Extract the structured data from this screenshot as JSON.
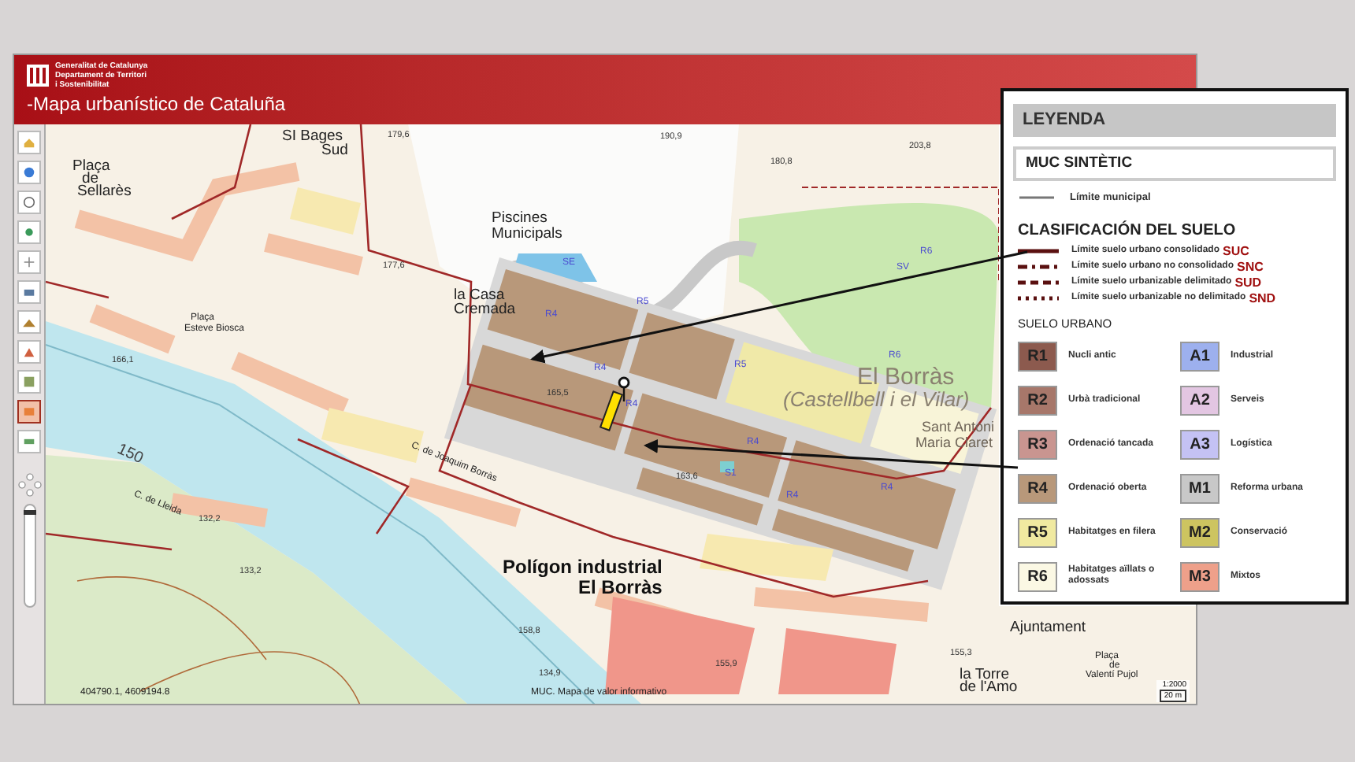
{
  "header": {
    "org_lines": [
      "Generalitat de Catalunya",
      "Departament de Territori",
      "i Sostenibilitat"
    ],
    "title": "-Mapa urbanístico de Cataluña"
  },
  "toolbar": {
    "tools": [
      {
        "selected": false
      },
      {
        "selected": false
      },
      {
        "selected": false
      },
      {
        "selected": false
      },
      {
        "selected": false
      },
      {
        "selected": false
      },
      {
        "selected": false
      },
      {
        "selected": false
      },
      {
        "selected": false
      },
      {
        "selected": true
      },
      {
        "selected": false
      }
    ],
    "zoom": {
      "level": 0.95
    }
  },
  "map": {
    "labels": [
      {
        "text": "SI Bages",
        "kind": "place"
      },
      {
        "text": "Sud",
        "kind": "place"
      },
      {
        "text": "Piscines",
        "kind": "place"
      },
      {
        "text": "Municipals",
        "kind": "place"
      },
      {
        "text": "Plaça",
        "kind": "small"
      },
      {
        "text": "Esteve Biosca",
        "kind": "small"
      },
      {
        "text": "la Casa",
        "kind": "place"
      },
      {
        "text": "Cremada",
        "kind": "place"
      },
      {
        "text": "El Borràs",
        "kind": "town"
      },
      {
        "text": "(Castellbell i el Vilar)",
        "kind": "town"
      },
      {
        "text": "Sant Antoni",
        "kind": "fade"
      },
      {
        "text": "Maria Claret",
        "kind": "fade"
      },
      {
        "text": "Polígon industrial",
        "kind": "bold"
      },
      {
        "text": "El Borràs",
        "kind": "bold"
      },
      {
        "text": "Ajuntament",
        "kind": "place"
      },
      {
        "text": "la Torre",
        "kind": "place"
      },
      {
        "text": "de l'Amo",
        "kind": "place"
      },
      {
        "text": "Plaça",
        "kind": "small"
      },
      {
        "text": "de",
        "kind": "small"
      },
      {
        "text": "Valentí Pujol",
        "kind": "small"
      },
      {
        "text": "Plaça",
        "kind": "place"
      },
      {
        "text": "de",
        "kind": "place"
      },
      {
        "text": "Sellarès",
        "kind": "place"
      },
      {
        "text": "C. de Joaquim Borràs",
        "kind": "street"
      },
      {
        "text": "C. de Lleida",
        "kind": "street"
      },
      {
        "text": "R4",
        "kind": "zone"
      },
      {
        "text": "R4",
        "kind": "zone"
      },
      {
        "text": "R4",
        "kind": "zone"
      },
      {
        "text": "R4",
        "kind": "zone"
      },
      {
        "text": "R4",
        "kind": "zone"
      },
      {
        "text": "R4",
        "kind": "zone"
      },
      {
        "text": "R5",
        "kind": "zone"
      },
      {
        "text": "R5",
        "kind": "zone"
      },
      {
        "text": "R6",
        "kind": "zone"
      },
      {
        "text": "R6",
        "kind": "zone"
      },
      {
        "text": "SE",
        "kind": "zone"
      },
      {
        "text": "SV",
        "kind": "zone"
      },
      {
        "text": "S1",
        "kind": "zone"
      },
      {
        "text": "150",
        "kind": "contour"
      },
      {
        "text": "190,9",
        "kind": "height"
      },
      {
        "text": "203,8",
        "kind": "height"
      },
      {
        "text": "180,8",
        "kind": "height"
      },
      {
        "text": "179,6",
        "kind": "height"
      },
      {
        "text": "177,6",
        "kind": "height"
      },
      {
        "text": "165,5",
        "kind": "height"
      },
      {
        "text": "166,1",
        "kind": "height"
      },
      {
        "text": "163,6",
        "kind": "height"
      },
      {
        "text": "158,8",
        "kind": "height"
      },
      {
        "text": "155,9",
        "kind": "height"
      },
      {
        "text": "155,3",
        "kind": "height"
      },
      {
        "text": "134,9",
        "kind": "height"
      },
      {
        "text": "133,2",
        "kind": "height"
      },
      {
        "text": "132,2",
        "kind": "height"
      }
    ]
  },
  "status": {
    "coordinates": "404790.1, 4609194.8",
    "note": "MUC. Mapa de valor informativo",
    "scale": "1:2000",
    "scale_bar": "20 m"
  },
  "legend": {
    "title": "LEYENDA",
    "subtitle": "MUC SINTÈTIC",
    "municipal": "Límite municipal",
    "classification_title": "CLASIFICACIÓN DEL SUELO",
    "limits": [
      {
        "kind": "solid",
        "text": "Límite suelo urbano consolidado",
        "code": "SUC"
      },
      {
        "kind": "dashdot",
        "text": "Límite suelo urbano no consolidado",
        "code": "SNC"
      },
      {
        "kind": "dash",
        "text": "Límite suelo urbanizable delimitado",
        "code": "SUD"
      },
      {
        "kind": "dot",
        "text": "Límite suelo urbanizable no delimitado",
        "code": "SND"
      }
    ],
    "urban_title": "SUELO URBANO",
    "zones": [
      {
        "code": "R1",
        "label": "Nucli antic",
        "color": "#8c5a4e"
      },
      {
        "code": "A1",
        "label": "Industrial",
        "color": "#9db0ee"
      },
      {
        "code": "R2",
        "label": "Urbà tradicional",
        "color": "#a7776a"
      },
      {
        "code": "A2",
        "label": "Serveis",
        "color": "#e3c6e2"
      },
      {
        "code": "R3",
        "label": "Ordenació tancada",
        "color": "#c99590"
      },
      {
        "code": "A3",
        "label": "Logística",
        "color": "#c4c2f4"
      },
      {
        "code": "R4",
        "label": "Ordenació oberta",
        "color": "#b8987a"
      },
      {
        "code": "M1",
        "label": "Reforma urbana",
        "color": "#c8c8c8"
      },
      {
        "code": "R5",
        "label": "Habitatges en filera",
        "color": "#f0e9a0"
      },
      {
        "code": "M2",
        "label": "Conservació",
        "color": "#cdc460"
      },
      {
        "code": "R6",
        "label": "Habitatges aïllats o adossats",
        "color": "#fbf8e4"
      },
      {
        "code": "M3",
        "label": "Mixtos",
        "color": "#eea08a"
      }
    ]
  }
}
